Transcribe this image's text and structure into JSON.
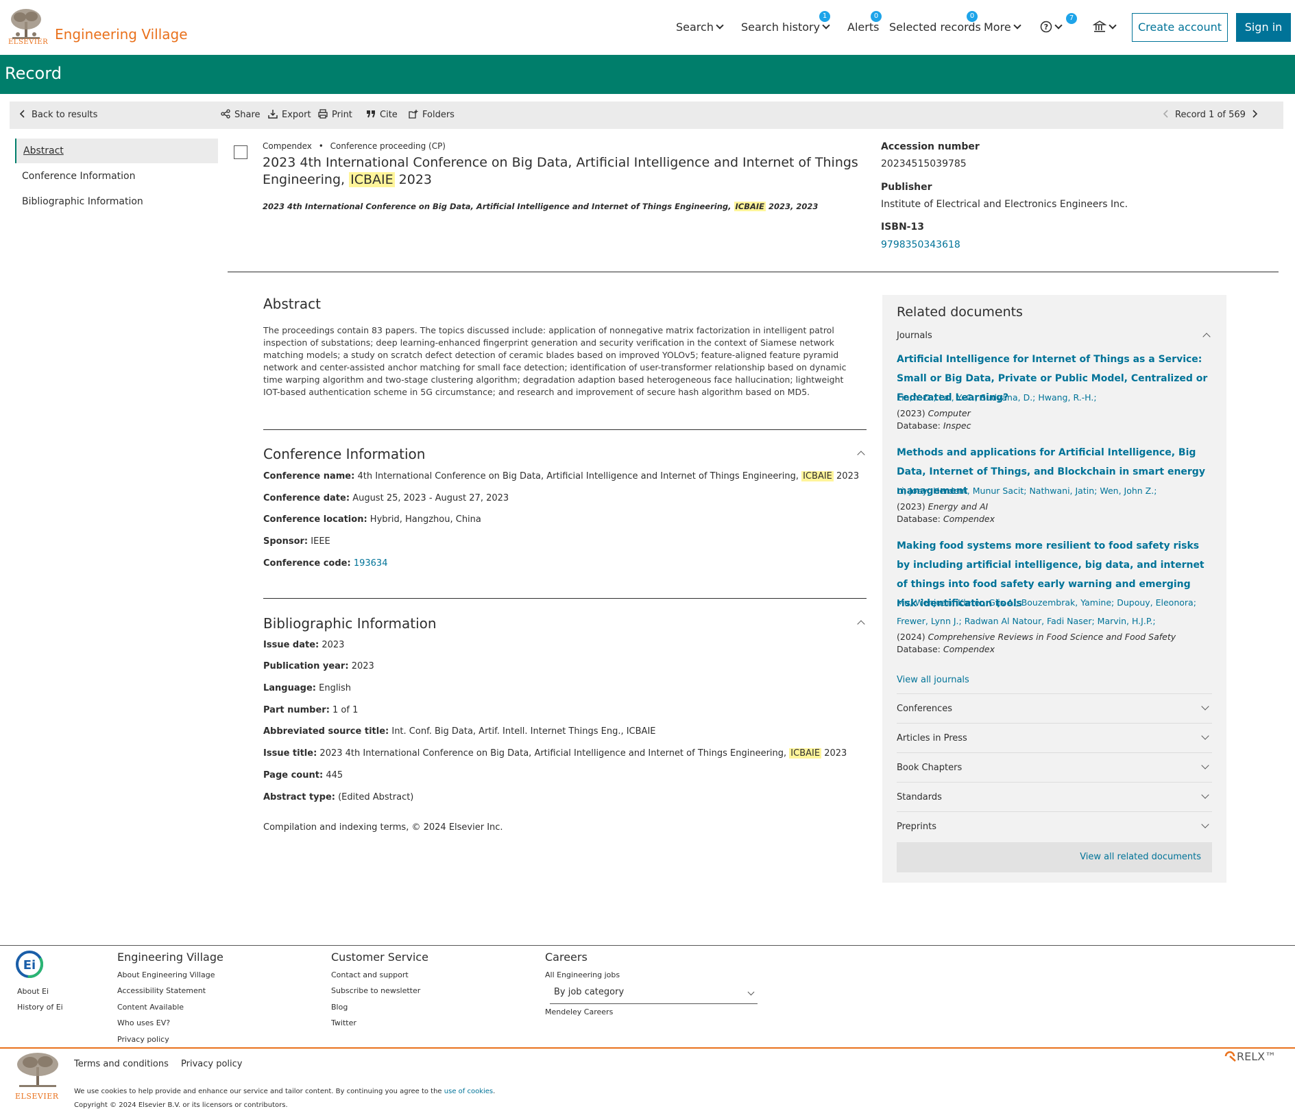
{
  "header": {
    "publisher_logo_text": "ELSEVIER",
    "brand": "Engineering Village",
    "nav": [
      {
        "label": "Search"
      },
      {
        "label": "Search history",
        "badge": "1"
      },
      {
        "label": "Alerts",
        "badge": "0"
      },
      {
        "label": "Selected records",
        "badge": "0"
      },
      {
        "label": "More"
      },
      {
        "label": "",
        "icon": "help-icon",
        "badge": "7"
      },
      {
        "label": "",
        "icon": "institution-icon"
      }
    ],
    "create_account": "Create account",
    "sign_in": "Sign in"
  },
  "banner": {
    "title": "Record"
  },
  "toolbar": {
    "back": "Back to results",
    "share": "Share",
    "export": "Export",
    "print": "Print",
    "cite": "Cite",
    "folders": "Folders",
    "record_position": "Record 1 of 569"
  },
  "left_nav": [
    "Abstract",
    "Conference Information",
    "Bibliographic Information"
  ],
  "record": {
    "database": "Compendex",
    "doc_type": "Conference proceeding (CP)",
    "title_pre": "2023 4th International Conference on Big Data, Artificial Intelligence and Internet of Things Engineering, ",
    "title_hl": "ICBAIE",
    "title_post": " 2023",
    "source_pre": "2023 4th International Conference on Big Data, Artificial Intelligence and Internet of Things Engineering, ",
    "source_hl": "ICBAIE",
    "source_post": " 2023, 2023",
    "meta": [
      {
        "label": "Accession number",
        "value": "20234515039785"
      },
      {
        "label": "Publisher",
        "value": "Institute of Electrical and Electronics Engineers Inc."
      },
      {
        "label": "ISBN-13",
        "value": "9798350343618"
      }
    ]
  },
  "abstract": {
    "title": "Abstract",
    "text": "The proceedings contain 83 papers. The topics discussed include: application of nonnegative matrix factorization in intelligent patrol inspection of substations; deep learning-enhanced fingerprint generation and security verification in the context of Siamese network matching models; a study on scratch defect detection of ceramic blades based on improved YOLOv5; feature-aligned feature pyramid network and center-assisted anchor matching for small face detection; identification of user-transformer relationship based on dynamic time warping algorithm and two-stage clustering algorithm; degradation adaption based heterogeneous face hallucination; lightweight IOT-based authentication scheme in 5G circumstance; and research and improvement of secure hash algorithm based on MD5."
  },
  "conference": {
    "title": "Conference Information",
    "name_label": "Conference name:",
    "name_pre": "4th International Conference on Big Data, Artificial Intelligence and Internet of Things Engineering, ",
    "name_hl": "ICBAIE",
    "name_post": " 2023",
    "date_label": "Conference date:",
    "date": "August 25, 2023 - August 27, 2023",
    "location_label": "Conference location:",
    "location": "Hybrid, Hangzhou, China",
    "sponsor_label": "Sponsor:",
    "sponsor": "IEEE",
    "code_label": "Conference code:",
    "code": "193634"
  },
  "bibliographic": {
    "title": "Bibliographic Information",
    "issue_date_label": "Issue date:",
    "issue_date": "2023",
    "pub_year_label": "Publication year:",
    "pub_year": "2023",
    "language_label": "Language:",
    "language": "English",
    "part_label": "Part number:",
    "part": "1 of 1",
    "abbr_label": "Abbreviated source title:",
    "abbr": "Int. Conf. Big Data, Artif. Intell. Internet Things Eng., ICBAIE",
    "issue_title_label": "Issue title:",
    "issue_title_pre": "2023 4th International Conference on Big Data, Artificial Intelligence and Internet of Things Engineering, ",
    "issue_title_hl": "ICBAIE",
    "issue_title_post": " 2023",
    "page_count_label": "Page count:",
    "page_count": "445",
    "abstract_type_label": "Abstract type:",
    "abstract_type": "(Edited Abstract)",
    "copyright": "Compilation and indexing terms, © 2024 Elsevier Inc."
  },
  "related": {
    "title": "Related documents",
    "journals_label": "Journals",
    "items": [
      {
        "title": "Artificial Intelligence for Internet of Things as a Service: Small or Big Data, Private or Public Model, Centralized or Federated Learning?",
        "authors": "Lin, Y.-D.; Lai, Y.-C.; Sudyana, D.; Hwang, R.-H.;",
        "source_year": "(2023)",
        "source": "Computer",
        "db_label": "Database:",
        "db": "Inspec"
      },
      {
        "title": "Methods and applications for Artificial Intelligence, Big Data, Internet of Things, and Blockchain in smart energy management",
        "authors": "Li, Joey;  Herdem, Munur Sacit; Nathwani, Jatin; Wen, John Z.;",
        "source_year": "(2023)",
        "source": "Energy and AI",
        "db_label": "Database:",
        "db": "Compendex"
      },
      {
        "title": "Making food systems more resilient to food safety risks by including artificial intelligence, big data, and internet of things into food safety early warning and emerging risk identification tools",
        "authors_1": "Mu, Wenjuan; Kleter, Gijs A.; Bouzembrak, Yamine; Dupouy, Eleonora;",
        "authors_2": "Frewer, Lynn J.; Radwan Al Natour, Fadi Naser; Marvin, H.J.P.;",
        "source_year": "(2024)",
        "source": "Comprehensive Reviews in Food Science and Food Safety",
        "db_label": "Database:",
        "db": "Compendex"
      }
    ],
    "view_all_journals": "View all journals",
    "categories": [
      "Conferences",
      "Articles in Press",
      "Book Chapters",
      "Standards",
      "Preprints"
    ],
    "view_all_related": "View all related documents"
  },
  "footer": {
    "logo_text": "Ei",
    "left_links": [
      "About Ei",
      "History of Ei"
    ],
    "columns": [
      {
        "title": "Engineering Village",
        "links": [
          "About Engineering Village",
          "Accessibility Statement",
          "Content Available",
          "Who uses EV?",
          "Privacy policy"
        ]
      },
      {
        "title": "Customer Service",
        "links": [
          "Contact and support",
          "Subscribe to newsletter",
          "Blog",
          "Twitter"
        ]
      },
      {
        "title": "Careers",
        "links": [
          "All Engineering jobs"
        ],
        "select_value": "By job category",
        "extra_link": "Mendeley Careers"
      }
    ],
    "bottom_links": [
      "Terms and conditions",
      "Privacy policy"
    ],
    "cookie_pre": "We use cookies to help provide and enhance our service and tailor content. By continuing you agree to the ",
    "cookie_link": "use of cookies",
    "cookie_post": ".",
    "copyright": "Copyright © 2024 Elsevier B.V. or its licensors or contributors.",
    "publisher_logo_text": "ELSEVIER",
    "relx": "RELX™"
  },
  "colors": {
    "brand_orange": "#e9711c",
    "banner_green": "#007e6b",
    "link_blue": "#007398",
    "badge_blue": "#1ea4e9",
    "highlight": "#fff59a"
  }
}
